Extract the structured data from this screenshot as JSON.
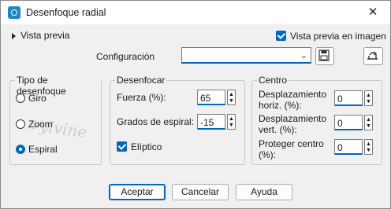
{
  "window": {
    "title": "Desenfoque radial"
  },
  "top": {
    "preview_label": "Vista previa",
    "image_preview_label": "Vista previa en imagen",
    "config_label": "Configuración",
    "config_value": ""
  },
  "groups": {
    "blur_type": {
      "title": "Tipo de desenfoque",
      "options": [
        "Giro",
        "Zoom",
        "Espiral"
      ],
      "selected": "Espiral"
    },
    "blur": {
      "title": "Desenfocar",
      "strength_label": "Fuerza (%):",
      "strength_value": "65",
      "spiral_label": "Grados de espiral:",
      "spiral_value": "-15",
      "elliptic_label": "Elíptico"
    },
    "center": {
      "title": "Centro",
      "horiz_label": "Desplazamiento horiz. (%):",
      "horiz_value": "0",
      "vert_label": "Desplazamiento vert. (%):",
      "vert_value": "0",
      "protect_label": "Proteger centro (%):",
      "protect_value": "0"
    }
  },
  "buttons": {
    "ok": "Aceptar",
    "cancel": "Cancelar",
    "help": "Ayuda"
  },
  "icons": {
    "app": "radial-blur-app-icon",
    "close": "close-icon",
    "save": "save-icon",
    "reset": "reset-icon",
    "dropdown": "chevron-down-icon"
  }
}
